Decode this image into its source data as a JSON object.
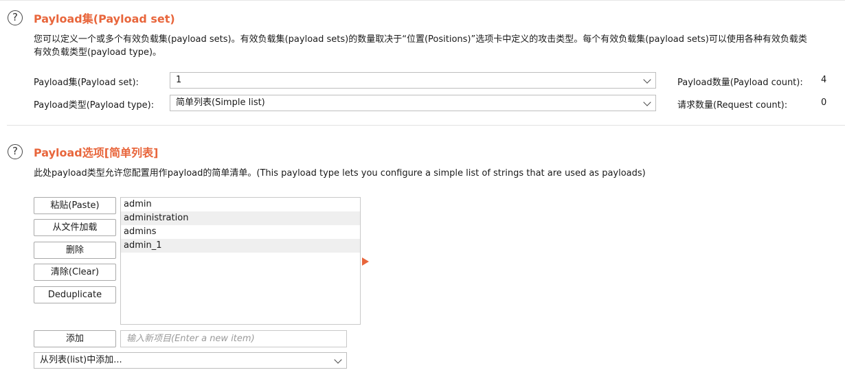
{
  "payload_sets": {
    "title": "Payload集(Payload set)",
    "desc_line1": "您可以定义一个或多个有效负载集(payload sets)。有效负载集(payload sets)的数量取决于“位置(Positions)”选项卡中定义的攻击类型。每个有效负载集(payload sets)可以使用各种有效负载类",
    "desc_line2": "有效负载类型(payload type)。",
    "set_label": "Payload集(Payload set):",
    "set_value": "1",
    "type_label": "Payload类型(Payload type):",
    "type_value": "简单列表(Simple list)",
    "count_label": "Payload数量(Payload count):",
    "count_value": "4",
    "request_label": "请求数量(Request count):",
    "request_value": "0"
  },
  "payload_options": {
    "title": "Payload选项[简单列表]",
    "desc": "此处payload类型允许您配置用作payload的简单清单。(This payload type lets you configure a simple list of strings that are used as payloads)",
    "buttons": {
      "paste": "粘贴(Paste)",
      "load": "从文件加载",
      "remove": "删除",
      "clear": "清除(Clear)",
      "dedup": "Deduplicate",
      "add": "添加"
    },
    "items": [
      "admin",
      "administration",
      "admins",
      "admin_1"
    ],
    "new_item_placeholder": "输入新项目(Enter a new item)",
    "add_from_list": "从列表(list)中添加..."
  },
  "icons": {
    "help": "help-icon",
    "chevron": "chevron-down-icon",
    "arrow": "arrow-right-icon"
  },
  "colors": {
    "accent": "#e8663c"
  }
}
